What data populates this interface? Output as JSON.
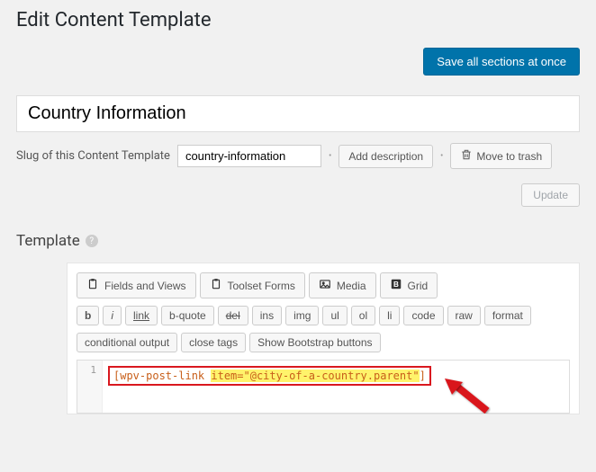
{
  "page_title": "Edit Content Template",
  "buttons": {
    "save_all": "Save all sections at once",
    "add_description": "Add description",
    "move_to_trash": "Move to trash",
    "update": "Update"
  },
  "title_field": {
    "value": "Country Information"
  },
  "slug": {
    "label": "Slug of this Content Template",
    "value": "country-information"
  },
  "section": {
    "template_label": "Template"
  },
  "toolbar": {
    "fields_views": "Fields and Views",
    "toolset_forms": "Toolset Forms",
    "media": "Media",
    "grid": "Grid",
    "b": "b",
    "i": "i",
    "link": "link",
    "bquote": "b-quote",
    "del": "del",
    "ins": "ins",
    "img": "img",
    "ul": "ul",
    "ol": "ol",
    "li": "li",
    "code": "code",
    "raw": "raw",
    "format": "format",
    "conditional": "conditional output",
    "close_tags": "close tags",
    "bootstrap": "Show Bootstrap buttons"
  },
  "code": {
    "line1_num": "1",
    "prefix": "[wpv-post-link ",
    "highlight": "item=\"@city-of-a-country.parent\"",
    "suffix": "]"
  }
}
